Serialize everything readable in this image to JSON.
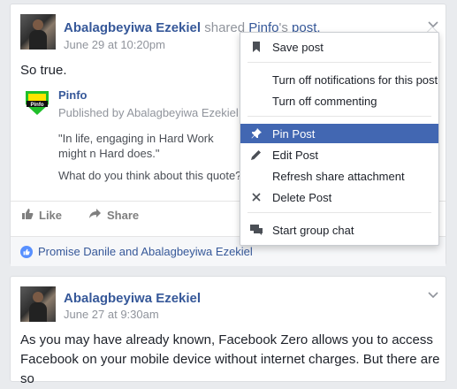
{
  "post1": {
    "author": "Abalagbeyiwa Ezekiel",
    "shared_prefix": "shared",
    "shared_page": "Pinfo",
    "shared_suffix": "'s",
    "shared_object": "post.",
    "time": "June 29 at 10:20pm",
    "text": "So true.",
    "attachment": {
      "title": "Pinfo",
      "published_by": "Published by Abalagbeyiwa Ezekiel [?",
      "quote": "\"In life, engaging in Hard Work might n Hard does.\"",
      "question": "What do you think about this quote?"
    },
    "actions": {
      "like": "Like",
      "share": "Share"
    },
    "likers": "Promise Danile and Abalagbeyiwa Ezekiel"
  },
  "menu": {
    "items": [
      {
        "label": "Save post",
        "icon": "bookmark-icon"
      },
      {
        "label": "Turn off notifications for this post",
        "icon": ""
      },
      {
        "label": "Turn off commenting",
        "icon": ""
      },
      {
        "label": "Pin Post",
        "icon": "pin-icon",
        "selected": true
      },
      {
        "label": "Edit Post",
        "icon": "pencil-icon"
      },
      {
        "label": "Refresh share attachment",
        "icon": ""
      },
      {
        "label": "Delete Post",
        "icon": "close-icon"
      },
      {
        "label": "Start group chat",
        "icon": "chat-icon"
      }
    ]
  },
  "post2": {
    "author": "Abalagbeyiwa Ezekiel",
    "time": "June 27 at 9:30am",
    "text": "As you may have already known, Facebook Zero allows you to access Facebook on your mobile device without internet charges. But there are so"
  },
  "colors": {
    "link": "#365899",
    "menu_selected": "#4267b2",
    "background": "#e9ebee"
  }
}
